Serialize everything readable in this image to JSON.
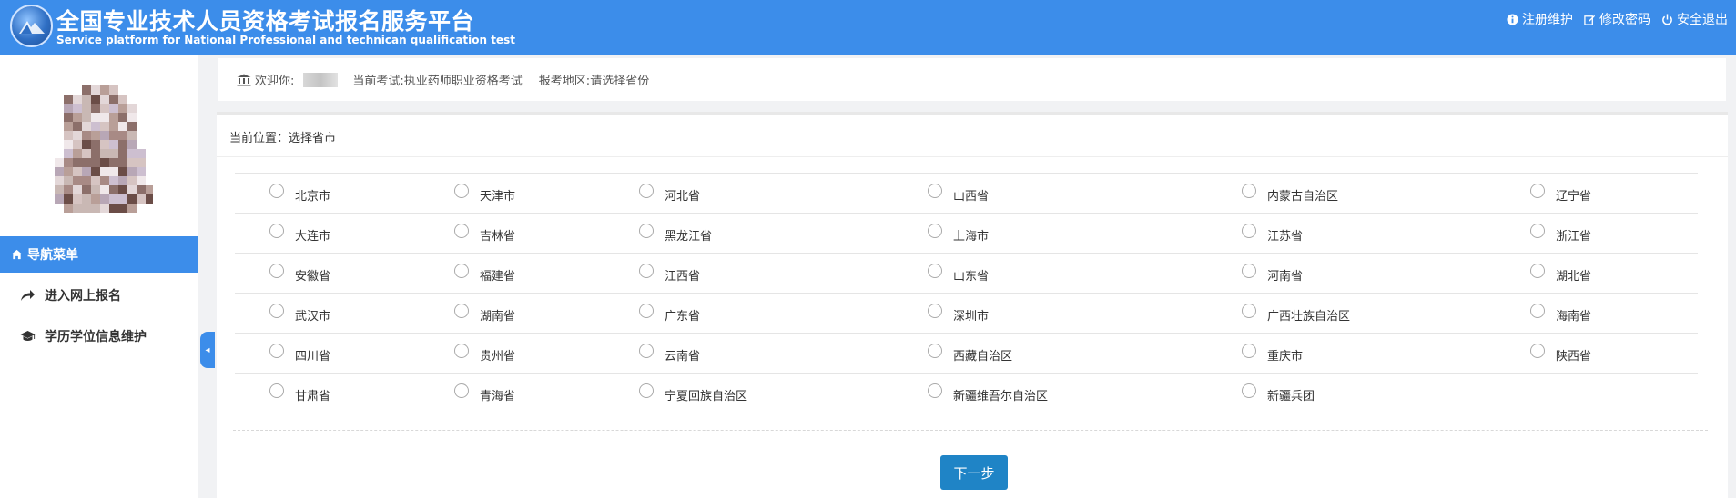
{
  "header": {
    "title_cn": "全国专业技术人员资格考试报名服务平台",
    "title_en": "Service platform for National Professional and technican qualification test",
    "logo_icon": "platform-logo",
    "actions": [
      {
        "label": "注册维护",
        "icon": "info-icon"
      },
      {
        "label": "修改密码",
        "icon": "edit-icon"
      },
      {
        "label": "安全退出",
        "icon": "power-icon"
      }
    ]
  },
  "sidebar": {
    "nav_header": "导航菜单",
    "items": [
      {
        "label": "进入网上报名",
        "icon": "share-arrow-icon"
      },
      {
        "label": "学历学位信息维护",
        "icon": "graduation-cap-icon"
      }
    ]
  },
  "welcome": {
    "greeting": "欢迎你:",
    "exam_label": "当前考试:",
    "exam_value": "执业药师职业资格考试",
    "region_label": "报考地区:",
    "region_value": "请选择省份"
  },
  "main": {
    "breadcrumb": "当前位置：选择省市",
    "rows": [
      [
        "北京市",
        "天津市",
        "河北省",
        "山西省",
        "内蒙古自治区",
        "辽宁省"
      ],
      [
        "大连市",
        "吉林省",
        "黑龙江省",
        "上海市",
        "江苏省",
        "浙江省"
      ],
      [
        "安徽省",
        "福建省",
        "江西省",
        "山东省",
        "河南省",
        "湖北省"
      ],
      [
        "武汉市",
        "湖南省",
        "广东省",
        "深圳市",
        "广西壮族自治区",
        "海南省"
      ],
      [
        "四川省",
        "贵州省",
        "云南省",
        "西藏自治区",
        "重庆市",
        "陕西省"
      ],
      [
        "甘肃省",
        "青海省",
        "宁夏回族自治区",
        "新疆维吾尔自治区",
        "新疆兵团"
      ]
    ],
    "next_button": "下一步"
  },
  "colors": {
    "primary": "#3c8dea",
    "button": "#1f84c6"
  }
}
